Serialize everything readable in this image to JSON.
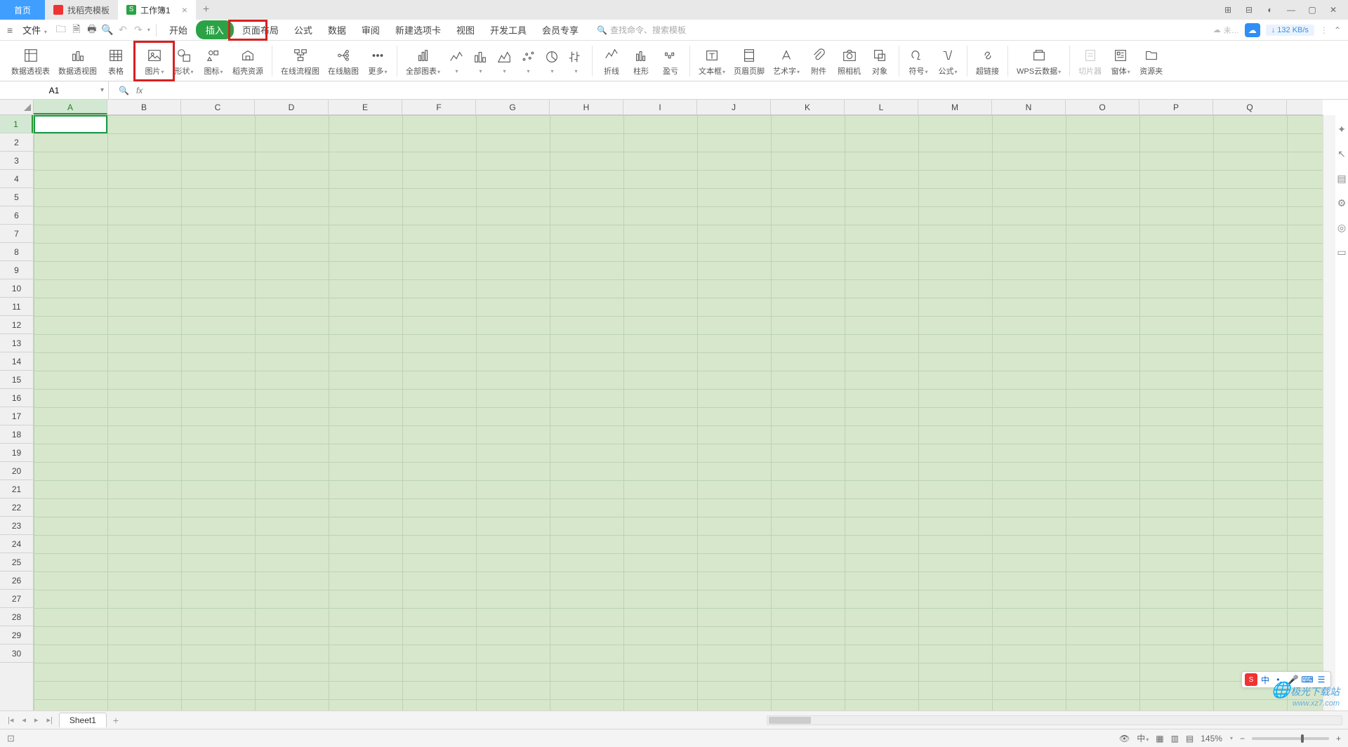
{
  "tabs": {
    "home": "首页",
    "template": "找稻壳模板",
    "workbook": "工作簿1"
  },
  "menu": {
    "file": "文件",
    "start": "开始",
    "insert": "插入",
    "layout": "页面布局",
    "formula": "公式",
    "data": "数据",
    "review": "审阅",
    "newtab": "新建选项卡",
    "view": "视图",
    "dev": "开发工具",
    "member": "会员专享",
    "search_ph": "查找命令、搜索模板"
  },
  "topright": {
    "unsync": "未…",
    "speed": "132 KB/s"
  },
  "ribbon": {
    "pivottable": "数据透视表",
    "pivotchart": "数据透视图",
    "table": "表格",
    "picture": "图片",
    "shape": "形状",
    "icon": "图标",
    "daokeres": "稻壳资源",
    "onlineflow": "在线流程图",
    "onlinemind": "在线脑图",
    "more": "更多",
    "allcharts": "全部图表",
    "sparkline": "折线",
    "column": "柱形",
    "winloss": "盈亏",
    "textbox": "文本框",
    "headerfooter": "页眉页脚",
    "wordart": "艺术字",
    "attach": "附件",
    "camera": "照相机",
    "object": "对象",
    "symbol": "符号",
    "equation": "公式",
    "hyperlink": "超链接",
    "wpscloud": "WPS云数据",
    "slicer": "切片器",
    "form": "窗体",
    "resource": "资源夹"
  },
  "namebox": "A1",
  "columns": [
    "A",
    "B",
    "C",
    "D",
    "E",
    "F",
    "G",
    "H",
    "I",
    "J",
    "K",
    "L",
    "M",
    "N",
    "O",
    "P",
    "Q"
  ],
  "rows": [
    "1",
    "2",
    "3",
    "4",
    "5",
    "6",
    "7",
    "8",
    "9",
    "10",
    "11",
    "12",
    "13",
    "14",
    "15",
    "16",
    "17",
    "18",
    "19",
    "20",
    "21",
    "22",
    "23",
    "24",
    "25",
    "26",
    "27",
    "28",
    "29",
    "30"
  ],
  "sheet": {
    "name": "Sheet1"
  },
  "status": {
    "zoom": "145%"
  },
  "watermark": {
    "brand": "极光下载站",
    "url": "www.xz7.com"
  },
  "ime": {
    "lang": "中"
  }
}
